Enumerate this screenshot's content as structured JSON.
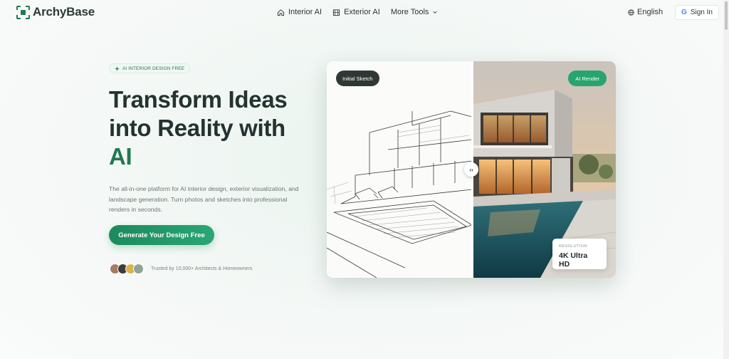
{
  "brand": {
    "name": "ArchyBase",
    "accent": "#1f7a52"
  },
  "nav": {
    "items": [
      {
        "label": "Interior AI",
        "icon": "home-icon"
      },
      {
        "label": "Exterior AI",
        "icon": "building-icon"
      },
      {
        "label": "More Tools",
        "icon": "chevron-down-icon"
      }
    ],
    "language": "English",
    "signin": "Sign In"
  },
  "hero": {
    "badge": "AI INTERIOR DESIGN FREE",
    "headline_line1": "Transform Ideas",
    "headline_line2": "into Reality with",
    "headline_accent": "AI",
    "description": "The all-in-one platform for AI interior design, exterior visualization, and landscape generation. Turn photos and sketches into professional renders in seconds.",
    "cta": "Generate Your Design Free",
    "trust_text": "Trusted by 10,000+ Architects & Homeowners",
    "avatar_colors": [
      "#a67c63",
      "#3b3d3a",
      "#d9b24a",
      "#8fa39b"
    ]
  },
  "showcase": {
    "before_label": "Initial Sketch",
    "after_label": "AI Render",
    "resolution_label": "RESOLUTION",
    "resolution_value": "4K Ultra HD"
  }
}
